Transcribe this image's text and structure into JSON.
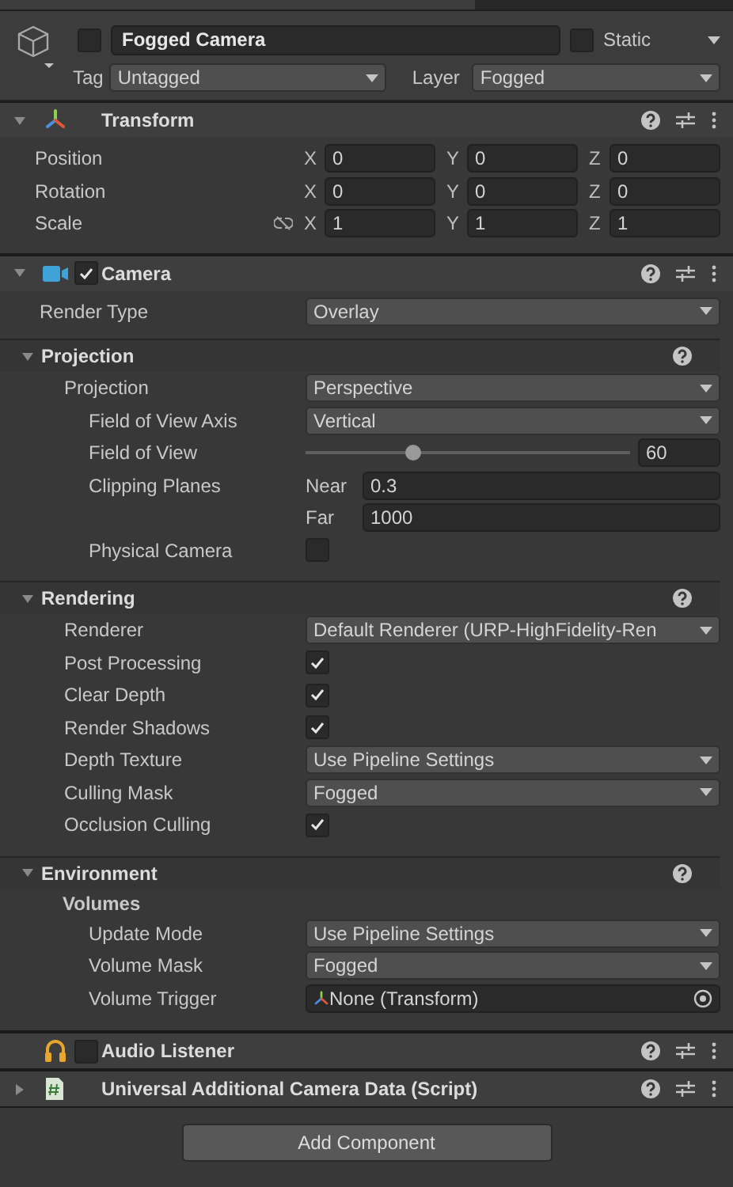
{
  "header": {
    "active": false,
    "name": "Fogged Camera",
    "static_label": "Static",
    "static": false,
    "tag_label": "Tag",
    "tag": "Untagged",
    "layer_label": "Layer",
    "layer": "Fogged"
  },
  "components": [
    {
      "kind": "transform",
      "title": "Transform",
      "expanded": true,
      "rows": [
        {
          "label": "Position",
          "axes": [
            {
              "axis": "X",
              "value": "0"
            },
            {
              "axis": "Y",
              "value": "0"
            },
            {
              "axis": "Z",
              "value": "0"
            }
          ]
        },
        {
          "label": "Rotation",
          "axes": [
            {
              "axis": "X",
              "value": "0"
            },
            {
              "axis": "Y",
              "value": "0"
            },
            {
              "axis": "Z",
              "value": "0"
            }
          ]
        },
        {
          "label": "Scale",
          "link_toggle": true,
          "axes": [
            {
              "axis": "X",
              "value": "1"
            },
            {
              "axis": "Y",
              "value": "1"
            },
            {
              "axis": "Z",
              "value": "1"
            }
          ]
        }
      ]
    },
    {
      "kind": "camera",
      "title": "Camera",
      "expanded": true,
      "enabled": true,
      "rows": [
        {
          "kind": "dropdown",
          "label": "Render Type",
          "value": "Overlay"
        },
        {
          "kind": "section",
          "label": "Projection",
          "expanded": true,
          "children": [
            {
              "kind": "dropdown",
              "label": "Projection",
              "value": "Perspective",
              "children": [
                {
                  "kind": "dropdown",
                  "label": "Field of View Axis",
                  "value": "Vertical"
                },
                {
                  "kind": "slider",
                  "label": "Field of View",
                  "level": 0.33,
                  "value": "60"
                },
                {
                  "kind": "pair",
                  "label": "Clipping Planes",
                  "items": [
                    {
                      "label": "Near",
                      "value": "0.3"
                    },
                    {
                      "label": "Far",
                      "value": "1000"
                    }
                  ]
                },
                {
                  "kind": "checkbox",
                  "label": "Physical Camera",
                  "checked": false
                }
              ]
            }
          ]
        },
        {
          "kind": "section",
          "label": "Rendering",
          "expanded": true,
          "children": [
            {
              "kind": "dropdown",
              "label": "Renderer",
              "value": "Default Renderer (URP-HighFidelity-Ren"
            },
            {
              "kind": "checkbox",
              "label": "Post Processing",
              "checked": true
            },
            {
              "kind": "checkbox",
              "label": "Clear Depth",
              "checked": true
            },
            {
              "kind": "checkbox",
              "label": "Render Shadows",
              "checked": true
            },
            {
              "kind": "dropdown",
              "label": "Depth Texture",
              "value": "Use Pipeline Settings"
            },
            {
              "kind": "dropdown",
              "label": "Culling Mask",
              "value": "Fogged"
            },
            {
              "kind": "checkbox",
              "label": "Occlusion Culling",
              "checked": true
            }
          ]
        },
        {
          "kind": "section",
          "label": "Environment",
          "expanded": true,
          "children": [
            {
              "kind": "heading",
              "label": "Volumes",
              "children": [
                {
                  "kind": "dropdown",
                  "label": "Update Mode",
                  "value": "Use Pipeline Settings"
                },
                {
                  "kind": "dropdown",
                  "label": "Volume Mask",
                  "value": "Fogged"
                },
                {
                  "kind": "object",
                  "label": "Volume Trigger",
                  "value": "None (Transform)"
                }
              ]
            }
          ]
        }
      ]
    },
    {
      "kind": "audio",
      "title": "Audio Listener",
      "enabled": false
    },
    {
      "kind": "script",
      "title": "Universal Additional Camera Data (Script)",
      "expanded": false
    }
  ],
  "add_button": "Add Component"
}
